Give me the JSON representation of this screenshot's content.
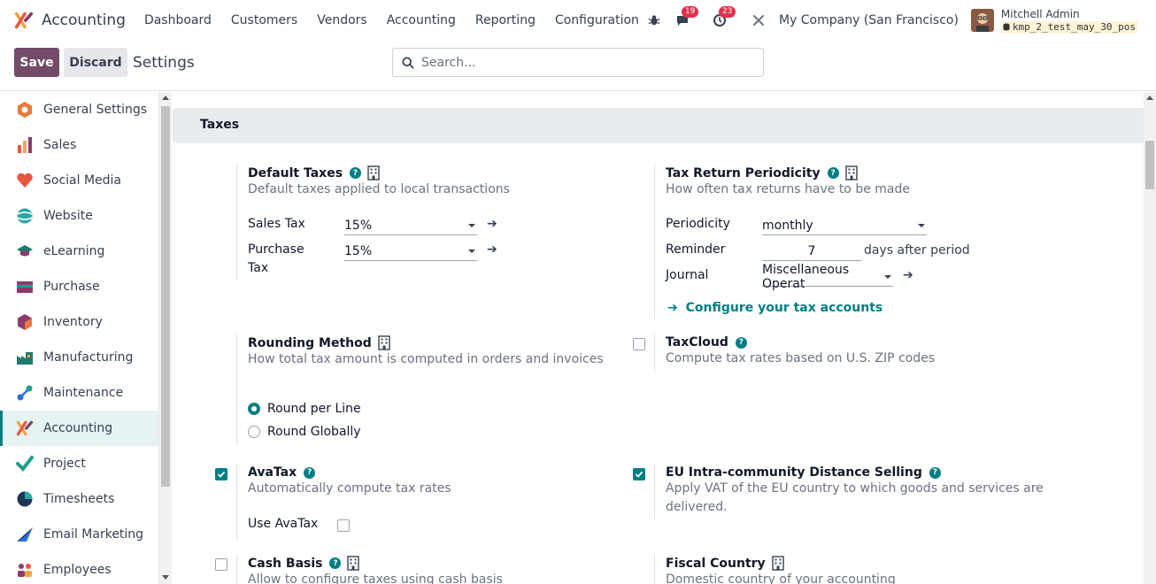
{
  "navbar": {
    "app_name": "Accounting",
    "menu": [
      "Dashboard",
      "Customers",
      "Vendors",
      "Accounting",
      "Reporting",
      "Configuration"
    ],
    "chat_count": "19",
    "activity_count": "23",
    "company": "My Company (San Francisco)",
    "user_name": "Mitchell Admin",
    "db_name": "kmp_2_test_may_30_pos"
  },
  "control": {
    "save_label": "Save",
    "discard_label": "Discard",
    "title": "Settings",
    "search_placeholder": "Search..."
  },
  "sidebar": {
    "items": [
      {
        "label": "General Settings",
        "icon": "general-settings-icon",
        "color": "#e8793a"
      },
      {
        "label": "Sales",
        "icon": "sales-icon",
        "color": "#f4a261"
      },
      {
        "label": "Social Media",
        "icon": "social-media-icon",
        "color": "#e9573f"
      },
      {
        "label": "Website",
        "icon": "website-icon",
        "color": "#2aa6a6"
      },
      {
        "label": "eLearning",
        "icon": "elearning-icon",
        "color": "#1f7a6e"
      },
      {
        "label": "Purchase",
        "icon": "purchase-icon",
        "color": "#8e3a6e"
      },
      {
        "label": "Inventory",
        "icon": "inventory-icon",
        "color": "#e8793a"
      },
      {
        "label": "Manufacturing",
        "icon": "manufacturing-icon",
        "color": "#1f7a6e"
      },
      {
        "label": "Maintenance",
        "icon": "maintenance-icon",
        "color": "#2a6fdb"
      },
      {
        "label": "Accounting",
        "icon": "accounting-icon",
        "color": "#714b67"
      },
      {
        "label": "Project",
        "icon": "project-icon",
        "color": "#1f9e8a"
      },
      {
        "label": "Timesheets",
        "icon": "timesheets-icon",
        "color": "#1d3557"
      },
      {
        "label": "Email Marketing",
        "icon": "email-marketing-icon",
        "color": "#2a6fdb"
      },
      {
        "label": "Employees",
        "icon": "employees-icon",
        "color": "#e9573f"
      }
    ]
  },
  "taxes": {
    "section_title": "Taxes",
    "default_taxes": {
      "title": "Default Taxes",
      "desc": "Default taxes applied to local transactions",
      "sales_label": "Sales Tax",
      "sales_value": "15%",
      "purchase_label_1": "Purchase",
      "purchase_label_2": "Tax",
      "purchase_value": "15%"
    },
    "periodicity": {
      "title": "Tax Return Periodicity",
      "desc": "How often tax returns have to be made",
      "periodicity_label": "Periodicity",
      "periodicity_value": "monthly",
      "reminder_label": "Reminder",
      "reminder_value": "7",
      "reminder_suffix": "days after period",
      "journal_label": "Journal",
      "journal_value": "Miscellaneous Operat",
      "configure_link": "Configure your tax accounts"
    },
    "rounding": {
      "title": "Rounding Method",
      "desc": "How total tax amount is computed in orders and invoices",
      "option_1": "Round per Line",
      "option_2": "Round Globally",
      "selected": "Round per Line"
    },
    "taxcloud": {
      "title": "TaxCloud",
      "desc": "Compute tax rates based on U.S. ZIP codes",
      "checked": false
    },
    "avatax": {
      "title": "AvaTax",
      "desc": "Automatically compute tax rates",
      "use_label": "Use AvaTax",
      "checked": true,
      "use_checked": false
    },
    "eu_distance": {
      "title": "EU Intra-community Distance Selling",
      "desc_1": "Apply VAT of the EU country to which goods and services are",
      "desc_2": "delivered.",
      "checked": true
    },
    "cash_basis": {
      "title": "Cash Basis",
      "desc": "Allow to configure taxes using cash basis",
      "checked": false
    },
    "fiscal_country": {
      "title": "Fiscal Country",
      "desc": "Domestic country of your accounting"
    }
  },
  "colors": {
    "brand": "#714b67",
    "accent": "#017e84",
    "badge": "#e0314d"
  }
}
